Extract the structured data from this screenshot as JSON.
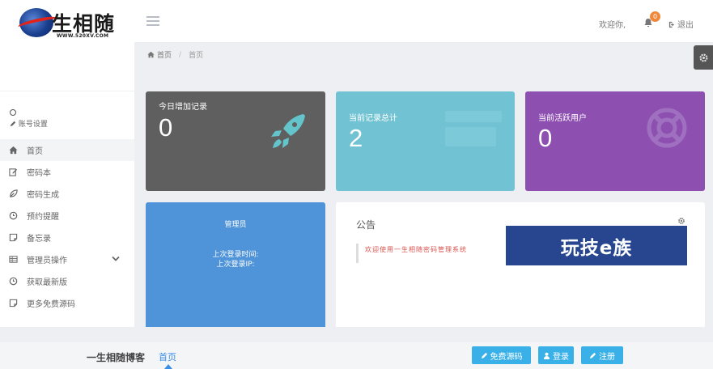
{
  "header": {
    "logo_text": "生相随",
    "logo_url": "WWW.520XV.COM",
    "welcome": "欢迎你,",
    "notification_count": "0",
    "logout_label": "退出"
  },
  "sidebar": {
    "account_settings": "账号设置",
    "items": [
      {
        "label": "首页",
        "icon": "home-icon"
      },
      {
        "label": "密码本",
        "icon": "edit-icon"
      },
      {
        "label": "密码生成",
        "icon": "leaf-icon"
      },
      {
        "label": "预约提醒",
        "icon": "clock-icon"
      },
      {
        "label": "备忘录",
        "icon": "note-icon"
      },
      {
        "label": "管理员操作",
        "icon": "table-icon"
      },
      {
        "label": "获取最新版",
        "icon": "clock-icon"
      },
      {
        "label": "更多免费源码",
        "icon": "note-icon"
      }
    ]
  },
  "breadcrumb": {
    "home": "首页",
    "current": "首页"
  },
  "stats": [
    {
      "label": "今日增加记录",
      "value": "0",
      "icon": "rocket-icon",
      "color": "#5f5f5f"
    },
    {
      "label": "当前记录总计",
      "value": "2",
      "icon": "",
      "color": "#71c3d4"
    },
    {
      "label": "当前活跃用户",
      "value": "0",
      "icon": "lifebuoy-icon",
      "color": "#8d4fb0"
    }
  ],
  "admin_card": {
    "title": "管理员",
    "last_login_time": "上次登录时间:",
    "last_login_ip": "上次登录IP:"
  },
  "notice": {
    "title": "公告",
    "message": "欢迎使用一生相随密码管理系统"
  },
  "watermark": {
    "text": "玩技e族"
  },
  "footer": {
    "brand": "一生相随博客",
    "home_link": "首页",
    "buttons": [
      "免费源码",
      "登录",
      "注册"
    ]
  }
}
